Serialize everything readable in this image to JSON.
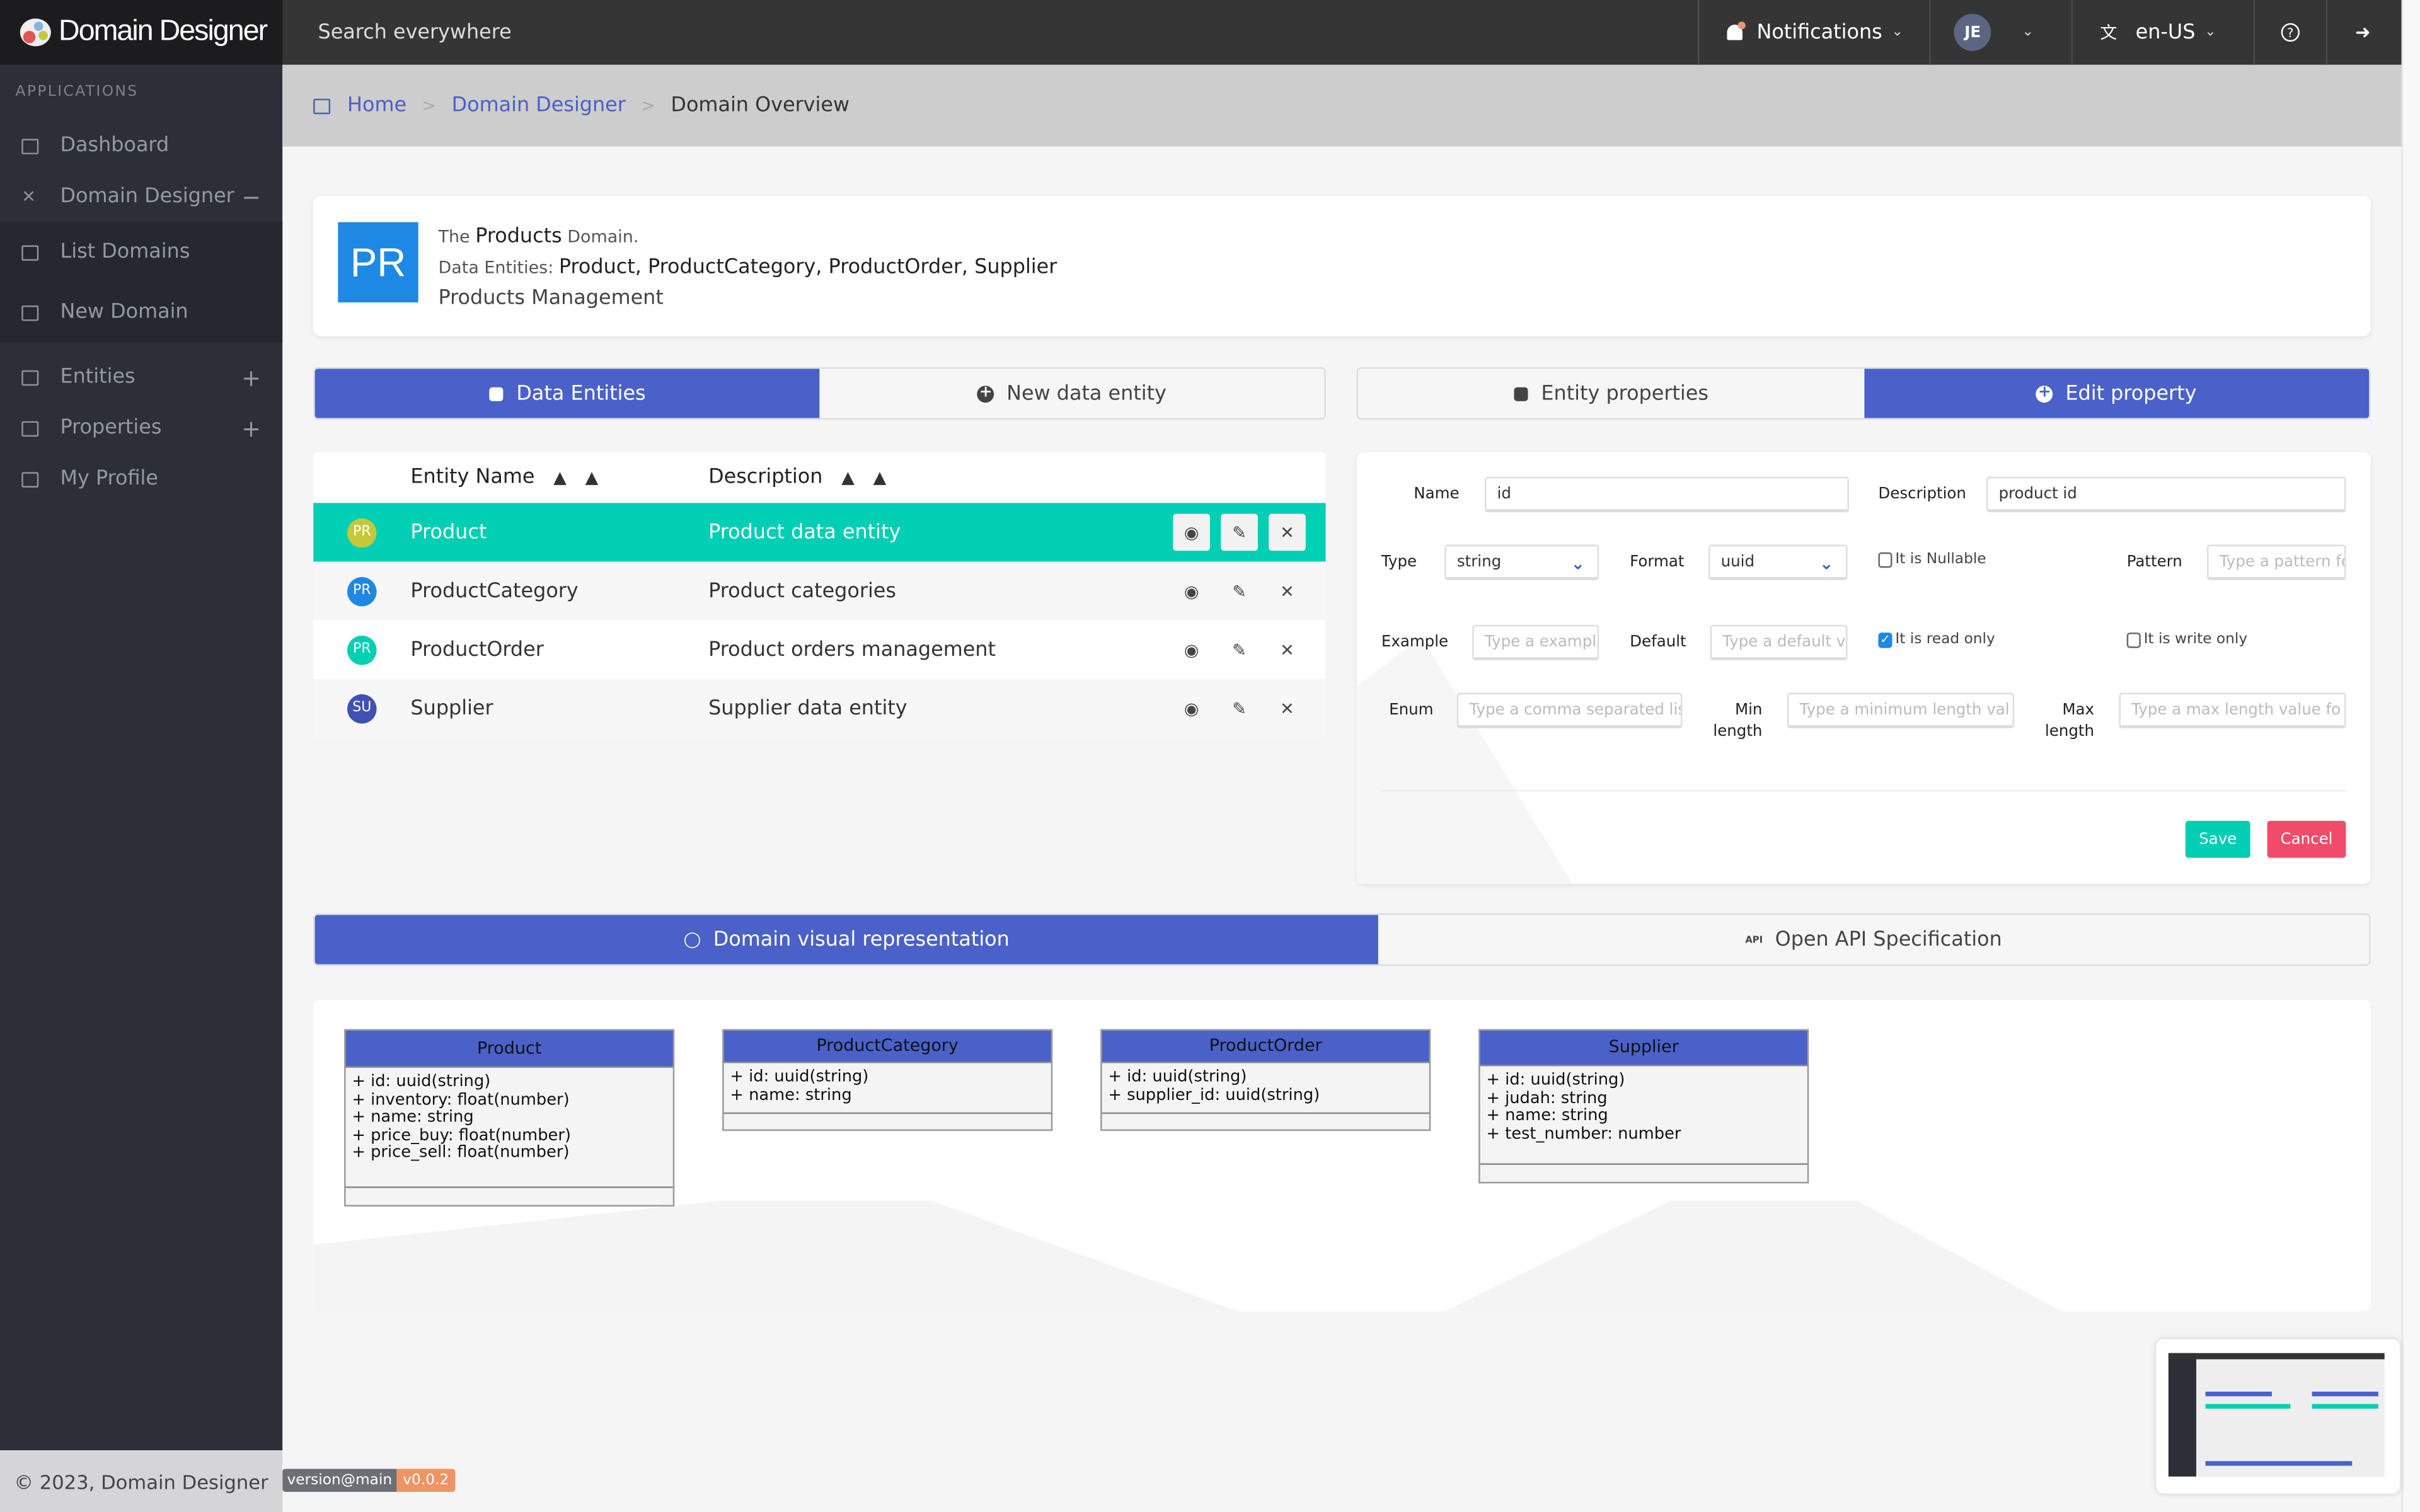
{
  "app": {
    "brand": "Domain Designer"
  },
  "header": {
    "search_placeholder": "Search everywhere",
    "notifications_label": "Notifications",
    "user_initials": "JE",
    "language": "en-US"
  },
  "sidebar": {
    "section_label": "APPLICATIONS",
    "items": [
      {
        "label": "Dashboard",
        "icon": "monitor-icon"
      },
      {
        "label": "Domain Designer",
        "icon": "tools-icon",
        "toggle": "−"
      },
      {
        "label": "List Domains",
        "icon": "table-icon"
      },
      {
        "label": "New Domain",
        "icon": "form-icon"
      },
      {
        "label": "Entities",
        "icon": "entity-icon",
        "toggle": "+"
      },
      {
        "label": "Properties",
        "icon": "entity-icon",
        "toggle": "+"
      },
      {
        "label": "My Profile",
        "icon": "profile-icon"
      }
    ]
  },
  "breadcrumb": {
    "items": [
      "Home",
      "Domain Designer",
      "Domain Overview"
    ],
    "separator": ">"
  },
  "domain": {
    "badge": "PR",
    "badge_color": "#1e88e5",
    "prefix": "The",
    "name": "Products",
    "suffix": "Domain.",
    "entities_label": "Data Entities:",
    "entities_list": "Product, ProductCategory, ProductOrder, Supplier",
    "description": "Products Management"
  },
  "left_tabs": [
    {
      "label": "Data Entities",
      "active": true
    },
    {
      "label": "New data entity",
      "active": false
    }
  ],
  "right_tabs": [
    {
      "label": "Entity properties",
      "active": false
    },
    {
      "label": "Edit property",
      "active": true
    }
  ],
  "entity_table": {
    "columns": [
      "Entity Name",
      "Description"
    ],
    "rows": [
      {
        "avatar": "PR",
        "avatar_color": "#c6c83c",
        "name": "Product",
        "description": "Product data entity",
        "selected": true
      },
      {
        "avatar": "PR",
        "avatar_color": "#1e88e5",
        "name": "ProductCategory",
        "description": "Product categories",
        "selected": false
      },
      {
        "avatar": "PR",
        "avatar_color": "#00cfb3",
        "name": "ProductOrder",
        "description": "Product orders management",
        "selected": false
      },
      {
        "avatar": "SU",
        "avatar_color": "#3f51b5",
        "name": "Supplier",
        "description": "Supplier data entity",
        "selected": false
      }
    ]
  },
  "property_form": {
    "name_label": "Name",
    "name_value": "id",
    "description_label": "Description",
    "description_value": "product id",
    "type_label": "Type",
    "type_value": "string",
    "format_label": "Format",
    "format_value": "uuid",
    "nullable_label": "It is Nullable",
    "nullable_checked": false,
    "pattern_label": "Pattern",
    "pattern_placeholder": "Type a pattern fo",
    "example_label": "Example",
    "example_placeholder": "Type a example",
    "default_label": "Default",
    "default_placeholder": "Type a default va",
    "readonly_label": "It is read only",
    "readonly_checked": true,
    "writeonly_label": "It is write only",
    "writeonly_checked": false,
    "enum_label": "Enum",
    "enum_placeholder": "Type a comma separated list c",
    "minlen_label_1": "Min",
    "minlen_label_2": "length",
    "minlen_placeholder": "Type a minimum length val",
    "maxlen_label_1": "Max",
    "maxlen_label_2": "length",
    "maxlen_placeholder": "Type a max length value fo",
    "save_label": "Save",
    "cancel_label": "Cancel"
  },
  "bottom_tabs": [
    {
      "label": "Domain visual representation",
      "active": true
    },
    {
      "label": "Open API Specification",
      "active": false
    }
  ],
  "diagram": {
    "classes": [
      {
        "name": "Product",
        "attributes": [
          "+ id: uuid(string)",
          "+ inventory: float(number)",
          "+ name: string",
          "+ price_buy: float(number)",
          "+ price_sell: float(number)"
        ]
      },
      {
        "name": "ProductCategory",
        "attributes": [
          "+ id: uuid(string)",
          "+ name: string"
        ]
      },
      {
        "name": "ProductOrder",
        "attributes": [
          "+ id: uuid(string)",
          "+ supplier_id: uuid(string)"
        ]
      },
      {
        "name": "Supplier",
        "attributes": [
          "+ id: uuid(string)",
          "+ judah: string",
          "+ name: string",
          "+ test_number: number"
        ]
      }
    ]
  },
  "footer": {
    "copyright": "© 2023, Domain Designer",
    "version_label": "version@main",
    "version": "v0.0.2"
  },
  "colors": {
    "primary": "#4a61c9",
    "selected_row": "#00cfb3",
    "save": "#00cfb3",
    "cancel": "#f24b6a"
  }
}
